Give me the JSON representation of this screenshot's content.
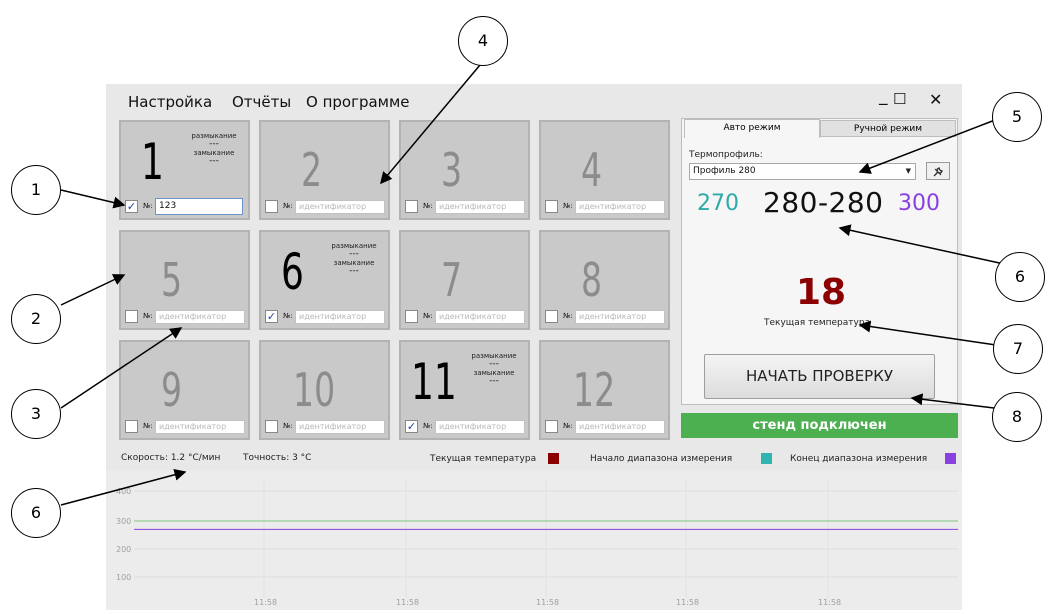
{
  "menu": {
    "settings": "Настройка",
    "reports": "Отчёты",
    "about": "О программе"
  },
  "window_controls": {
    "minimize": "_",
    "maximize": "☐",
    "close": "✕"
  },
  "cells": [
    {
      "number": "1",
      "active": true,
      "checked": true,
      "no_label": "№:",
      "id_value": "123",
      "id_placeholder": "",
      "opening": "размыкание",
      "opening_val": "---",
      "closing": "замыкание",
      "closing_val": "---"
    },
    {
      "number": "2",
      "active": false,
      "checked": false,
      "no_label": "№:",
      "id_value": "",
      "id_placeholder": "идентификатор"
    },
    {
      "number": "3",
      "active": false,
      "checked": false,
      "no_label": "№:",
      "id_value": "",
      "id_placeholder": "идентификатор"
    },
    {
      "number": "4",
      "active": false,
      "checked": false,
      "no_label": "№:",
      "id_value": "",
      "id_placeholder": "идентификатор"
    },
    {
      "number": "5",
      "active": false,
      "checked": false,
      "no_label": "№:",
      "id_value": "",
      "id_placeholder": "идентификатор"
    },
    {
      "number": "6",
      "active": true,
      "checked": true,
      "no_label": "№:",
      "id_value": "",
      "id_placeholder": "идентификатор",
      "opening": "размыкание",
      "opening_val": "---",
      "closing": "замыкание",
      "closing_val": "---"
    },
    {
      "number": "7",
      "active": false,
      "checked": false,
      "no_label": "№:",
      "id_value": "",
      "id_placeholder": "идентификатор"
    },
    {
      "number": "8",
      "active": false,
      "checked": false,
      "no_label": "№:",
      "id_value": "",
      "id_placeholder": "идентификатор"
    },
    {
      "number": "9",
      "active": false,
      "checked": false,
      "no_label": "№:",
      "id_value": "",
      "id_placeholder": "идентификатор"
    },
    {
      "number": "10",
      "active": false,
      "checked": false,
      "no_label": "№:",
      "id_value": "",
      "id_placeholder": "идентификатор"
    },
    {
      "number": "11",
      "active": true,
      "checked": true,
      "no_label": "№:",
      "id_value": "",
      "id_placeholder": "идентификатор",
      "opening": "размыкание",
      "opening_val": "---",
      "closing": "замыкание",
      "closing_val": "---"
    },
    {
      "number": "12",
      "active": false,
      "checked": false,
      "no_label": "№:",
      "id_value": "",
      "id_placeholder": "идентификатор"
    }
  ],
  "tabs": {
    "auto": "Авто режим",
    "manual": "Ручной режим"
  },
  "thermoprofile": {
    "label": "Термопрофиль:",
    "selected": "Профиль 280",
    "settings_icon": "wrench-icon"
  },
  "range": {
    "start": "270",
    "target": "280-280",
    "end": "300",
    "start_color": "#2eaaa8",
    "end_color": "#8a3fe0"
  },
  "current_temp": {
    "value": "18",
    "label": "Текущая температура",
    "color": "#8b0000"
  },
  "start_button": "НАЧАТЬ ПРОВЕРКУ",
  "status": {
    "text": "стенд подключен",
    "color": "#4caf50"
  },
  "stats": {
    "speed": "Скорость: 1.2 °С/мин",
    "accuracy": "Точность: 3 °С"
  },
  "legend": [
    {
      "label": "Текущая температура",
      "color": "#8b0000"
    },
    {
      "label": "Начало диапазона измерения",
      "color": "#2eb5b0"
    },
    {
      "label": "Конец диапазона измерения",
      "color": "#8a3fe0"
    }
  ],
  "annotations": [
    "1",
    "2",
    "3",
    "4",
    "5",
    "6",
    "6",
    "7",
    "8"
  ],
  "chart_data": {
    "type": "line",
    "y_ticks": [
      "400",
      "300",
      "200",
      "100"
    ],
    "ylim": [
      50,
      400
    ],
    "x_ticks": [
      "11:58",
      "11:58",
      "11:58",
      "11:58",
      "11:58"
    ],
    "series": [
      {
        "values": [
          300,
          300
        ],
        "color": "#7cc67c"
      },
      {
        "values": [
          270,
          270
        ],
        "color": "#8a3fe0"
      }
    ],
    "grid": true
  }
}
